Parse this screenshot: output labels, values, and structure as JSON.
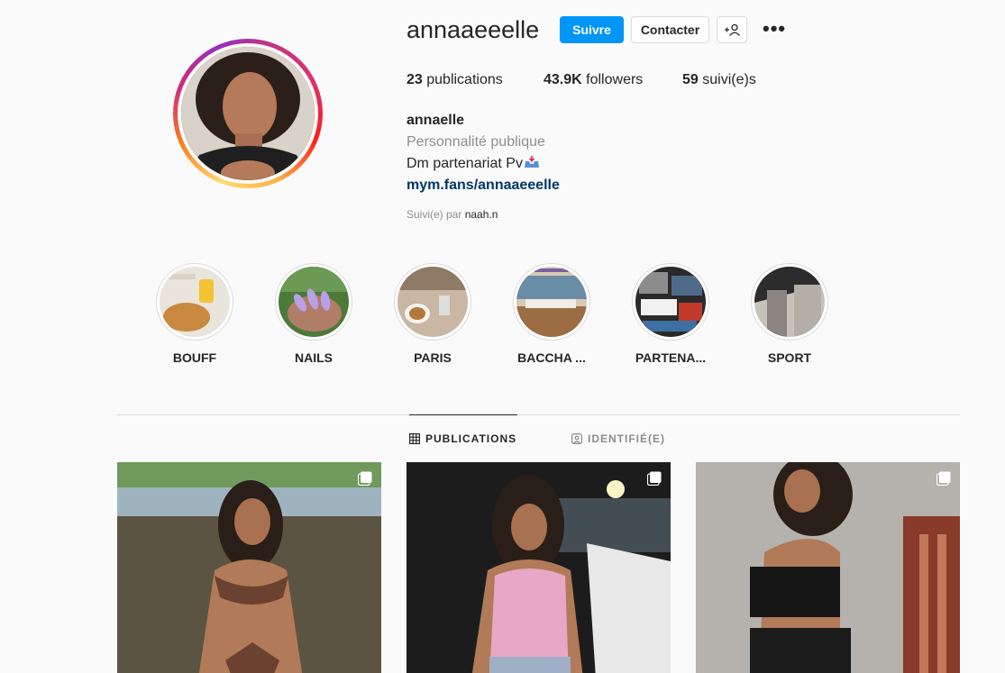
{
  "profile": {
    "username": "annaaeeelle",
    "follow_label": "Suivre",
    "contact_label": "Contacter",
    "suggest_label": "+👤",
    "more_label": "•••",
    "stats": {
      "posts_count": "23",
      "posts_label": "publications",
      "followers_count": "43.9K",
      "followers_label": "followers",
      "following_count": "59",
      "following_label": "suivi(e)s"
    },
    "full_name": "annaelle",
    "category": "Personnalité publique",
    "bio": "Dm partenariat Pv",
    "link": "mym.fans/annaaeeelle",
    "followed_by_prefix": "Suivi(e) par",
    "followed_by_user": "naah.n"
  },
  "highlights": [
    {
      "label": "BOUFF"
    },
    {
      "label": "NAILS"
    },
    {
      "label": "PARIS"
    },
    {
      "label": "BACCHA ..."
    },
    {
      "label": "PARTENA..."
    },
    {
      "label": "SPORT"
    }
  ],
  "tabs": {
    "posts": "PUBLICATIONS",
    "tagged": "IDENTIFIÉ(E)"
  },
  "colors": {
    "follow_button": "#0095f6",
    "link": "#00376b",
    "muted": "#8e8e8e"
  },
  "icons": {
    "posts_tab": "grid-icon",
    "tagged_tab": "tagged-icon",
    "post_multi": "carousel-icon"
  }
}
